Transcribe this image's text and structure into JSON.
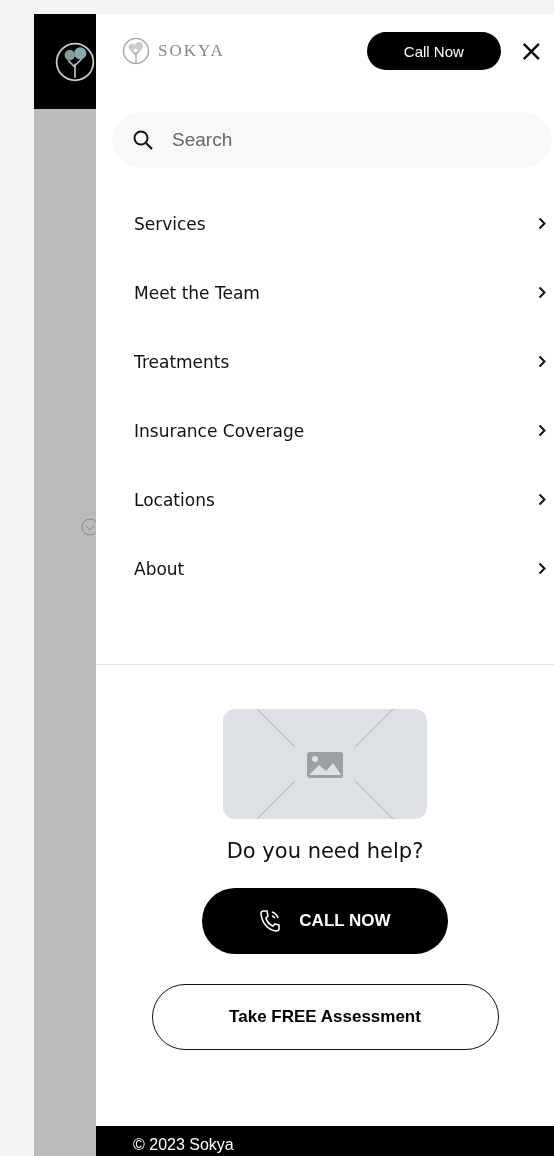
{
  "header": {
    "brand": "SOKYA",
    "call_button": "Call Now",
    "close": "×"
  },
  "search": {
    "placeholder": "Search"
  },
  "menu": [
    {
      "label": "Services"
    },
    {
      "label": "Meet the Team"
    },
    {
      "label": "Treatments"
    },
    {
      "label": "Insurance Coverage"
    },
    {
      "label": "Locations"
    },
    {
      "label": "About"
    }
  ],
  "help": {
    "title": "Do you need help?",
    "call_button": "CALL NOW",
    "assessment_button": "Take FREE Assessment"
  },
  "footer": {
    "copyright": "© 2023 Sokya"
  }
}
